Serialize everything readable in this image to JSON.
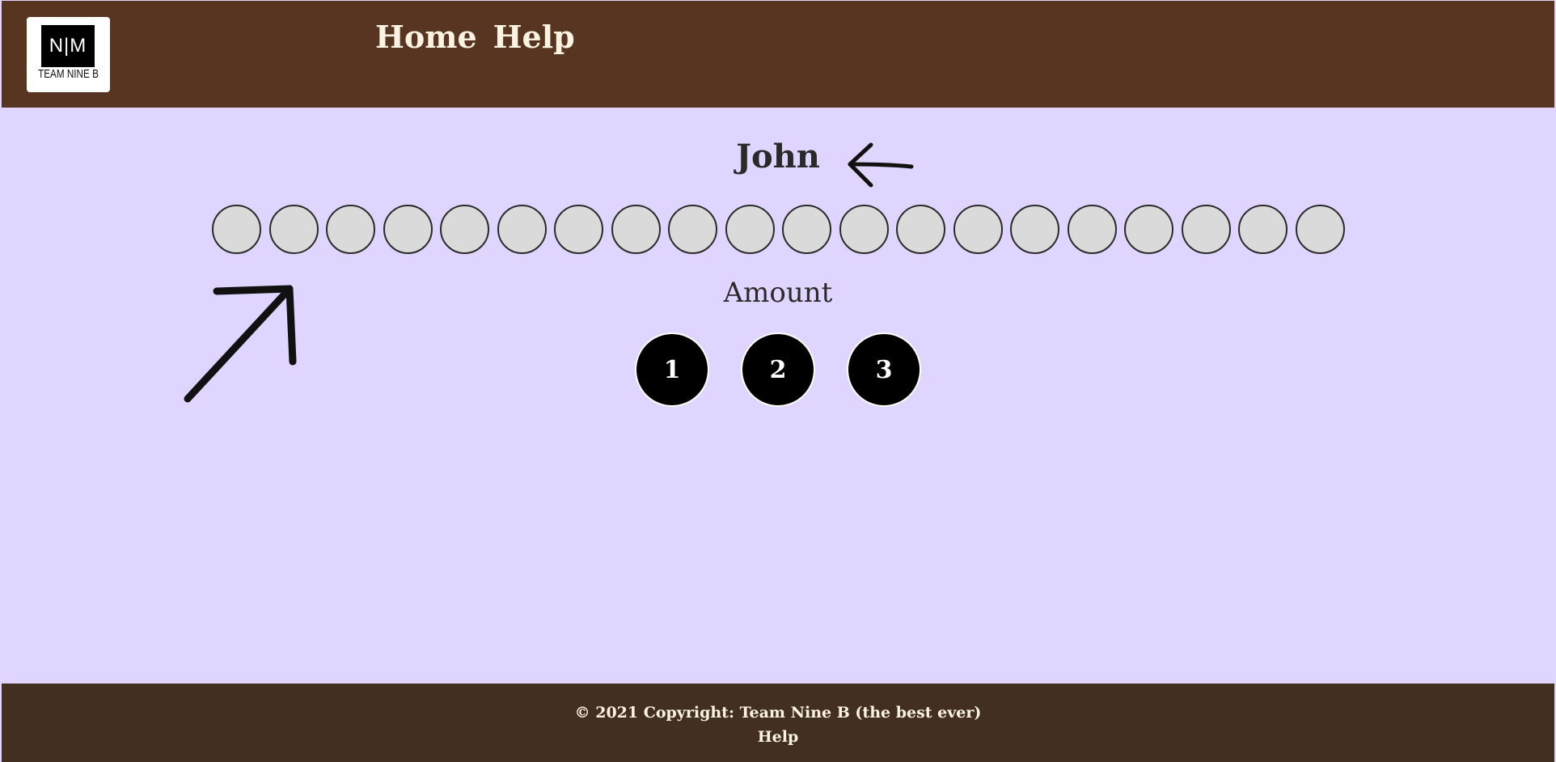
{
  "header": {
    "logo": {
      "mark": "N|M",
      "team": "TEAM NINE B"
    },
    "nav": {
      "home": "Home",
      "help": "Help"
    }
  },
  "game": {
    "current_player": "John",
    "stone_count": 20,
    "amount_label": "Amount",
    "amount_options": [
      "1",
      "2",
      "3"
    ]
  },
  "footer": {
    "copyright": "© 2021 Copyright: Team Nine B (the best ever)",
    "help_link": "Help"
  },
  "icons": {
    "turn_indicator": "arrow-left-icon",
    "hint": "arrow-up-right-icon"
  },
  "colors": {
    "header_bg": "#573521",
    "page_bg": "#e0d5fe",
    "footer_bg": "#422f21",
    "stone": "#dadada",
    "button": "#000000"
  }
}
